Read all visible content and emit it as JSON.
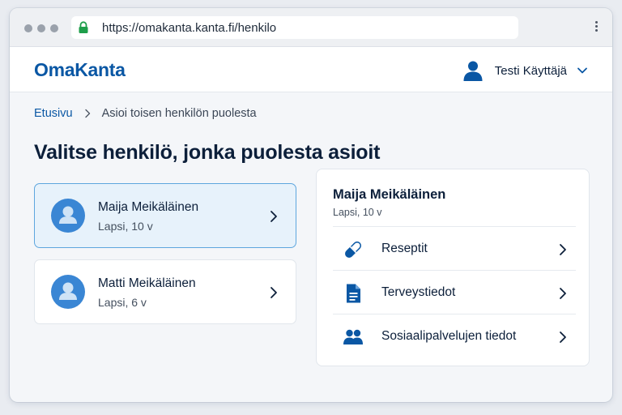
{
  "browser": {
    "url": "https://omakanta.kanta.fi/henkilo"
  },
  "header": {
    "logo": "OmaKanta",
    "user_name": "Testi Käyttäjä"
  },
  "breadcrumb": {
    "home": "Etusivu",
    "current": "Asioi toisen henkilön puolesta"
  },
  "page_title": "Valitse henkilö, jonka puolesta asioit",
  "persons": [
    {
      "name": "Maija Meikäläinen",
      "detail": "Lapsi, 10 v",
      "selected": true
    },
    {
      "name": "Matti Meikäläinen",
      "detail": "Lapsi, 6 v",
      "selected": false
    }
  ],
  "detail_panel": {
    "name": "Maija Meikäläinen",
    "detail": "Lapsi, 10 v",
    "rows": [
      {
        "label": "Reseptit",
        "icon": "pill-icon"
      },
      {
        "label": "Terveystiedot",
        "icon": "document-icon"
      },
      {
        "label": "Sosiaalipalvelujen tiedot",
        "icon": "people-icon"
      }
    ]
  },
  "colors": {
    "brand": "#0a57a4",
    "accent": "#3a86d4",
    "selected_bg": "#e7f2fb",
    "selected_border": "#5ea6de",
    "lock_green": "#1e9e4a"
  }
}
